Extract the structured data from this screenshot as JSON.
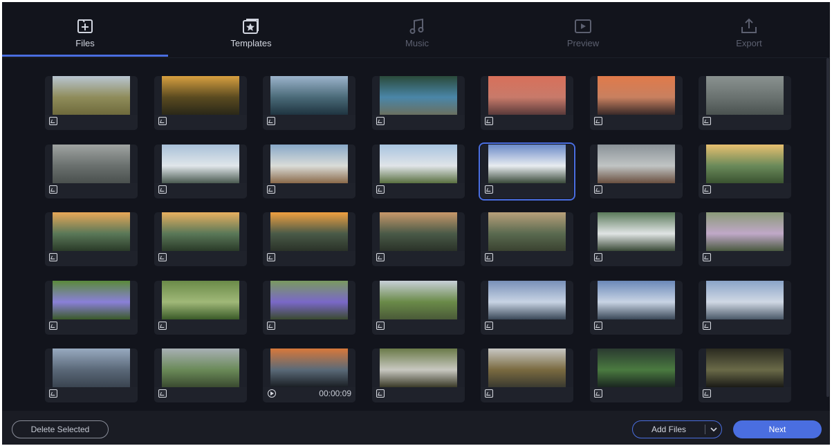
{
  "nav": {
    "tabs": [
      {
        "label": "Files",
        "icon": "add-file-icon",
        "state": "active"
      },
      {
        "label": "Templates",
        "icon": "templates-star-icon",
        "state": "enabled"
      },
      {
        "label": "Music",
        "icon": "music-note-icon",
        "state": "disabled"
      },
      {
        "label": "Preview",
        "icon": "play-preview-icon",
        "state": "disabled"
      },
      {
        "label": "Export",
        "icon": "upload-export-icon",
        "state": "disabled"
      }
    ],
    "accent": "#4a6ee0"
  },
  "grid": {
    "selected_index": 11,
    "items": [
      {
        "type": "image",
        "scene": "field-path",
        "colors": [
          "#b9c6d2",
          "#8f8c5a",
          "#6e6a3c"
        ]
      },
      {
        "type": "image",
        "scene": "sunset-trees",
        "colors": [
          "#d8a040",
          "#5a4a20",
          "#2a2818"
        ]
      },
      {
        "type": "image",
        "scene": "lake-mountains",
        "colors": [
          "#9cb4cc",
          "#4a6a78",
          "#1f3440"
        ]
      },
      {
        "type": "image",
        "scene": "lakeshore-forest",
        "colors": [
          "#2a4a3a",
          "#4a86a8",
          "#6a7060"
        ]
      },
      {
        "type": "image",
        "scene": "pink-sunset-water",
        "colors": [
          "#d8705a",
          "#c87a6a",
          "#5a3a3a"
        ]
      },
      {
        "type": "image",
        "scene": "orange-sunset-shore",
        "colors": [
          "#e07a4a",
          "#c88060",
          "#3a2a28"
        ]
      },
      {
        "type": "image",
        "scene": "sea-waves",
        "colors": [
          "#8a9290",
          "#6a7270",
          "#4a5250"
        ]
      },
      {
        "type": "image",
        "scene": "grey-sea",
        "colors": [
          "#a0a4a2",
          "#6a706e",
          "#4a504e"
        ]
      },
      {
        "type": "image",
        "scene": "clouds-mountains",
        "colors": [
          "#a8c0d8",
          "#e0e6ea",
          "#4a5a50"
        ]
      },
      {
        "type": "image",
        "scene": "big-clouds-valley",
        "colors": [
          "#88a8c8",
          "#dadcd8",
          "#8a6a4a"
        ]
      },
      {
        "type": "image",
        "scene": "snowy-ridge",
        "colors": [
          "#a8c4e0",
          "#e0e4e8",
          "#5a7040"
        ]
      },
      {
        "type": "image",
        "scene": "volcano",
        "colors": [
          "#6a8ac8",
          "#e8ecf0",
          "#3a4a3a"
        ]
      },
      {
        "type": "image",
        "scene": "misty-mountain",
        "colors": [
          "#8a9298",
          "#c0c4c4",
          "#6a5040"
        ]
      },
      {
        "type": "image",
        "scene": "sunset-meadow",
        "colors": [
          "#e8c070",
          "#6a8a5a",
          "#3a5230"
        ]
      },
      {
        "type": "image",
        "scene": "sunset-hills-1",
        "colors": [
          "#e8a858",
          "#5a7858",
          "#2a3a28"
        ]
      },
      {
        "type": "image",
        "scene": "sunset-hills-2",
        "colors": [
          "#e8b060",
          "#5a7858",
          "#2a3a28"
        ]
      },
      {
        "type": "image",
        "scene": "sun-low-hills",
        "colors": [
          "#f0a040",
          "#4a5a48",
          "#2a3228"
        ]
      },
      {
        "type": "image",
        "scene": "dusk-hill",
        "colors": [
          "#c8986a",
          "#4a5a48",
          "#2a3228"
        ]
      },
      {
        "type": "image",
        "scene": "evening-hills",
        "colors": [
          "#b8a07a",
          "#5a6a50",
          "#3a4230"
        ]
      },
      {
        "type": "image",
        "scene": "waterfall",
        "colors": [
          "#5a7a5a",
          "#e0e4e4",
          "#3a4a38"
        ]
      },
      {
        "type": "image",
        "scene": "wildflowers",
        "colors": [
          "#8a9a78",
          "#c0a8c8",
          "#4a5a40"
        ]
      },
      {
        "type": "image",
        "scene": "bluebell-flower",
        "colors": [
          "#5a8a3a",
          "#8a80d8",
          "#3a5a28"
        ]
      },
      {
        "type": "image",
        "scene": "grass-closeup",
        "colors": [
          "#6a8a48",
          "#a0b878",
          "#3a5a28"
        ]
      },
      {
        "type": "image",
        "scene": "iris-flowers",
        "colors": [
          "#7a9a60",
          "#7a68c8",
          "#3a4a30"
        ]
      },
      {
        "type": "image",
        "scene": "green-valley",
        "colors": [
          "#c8d0d8",
          "#6a8a48",
          "#4a5a38"
        ]
      },
      {
        "type": "image",
        "scene": "bay-clouds",
        "colors": [
          "#7890b8",
          "#c8d4e4",
          "#3a4858"
        ]
      },
      {
        "type": "image",
        "scene": "bay-ship",
        "colors": [
          "#6a88b8",
          "#c8d4e4",
          "#3a4858"
        ]
      },
      {
        "type": "image",
        "scene": "bay-volcano",
        "colors": [
          "#8aa4c8",
          "#d0d8e4",
          "#4a5868"
        ]
      },
      {
        "type": "image",
        "scene": "coast-range",
        "colors": [
          "#98aac0",
          "#5a6878",
          "#3a4450"
        ]
      },
      {
        "type": "image",
        "scene": "overcast-meadow",
        "colors": [
          "#a8b0b4",
          "#6a8a58",
          "#3a4a30"
        ]
      },
      {
        "type": "video",
        "scene": "fire-water",
        "duration": "00:00:09",
        "colors": [
          "#d8783a",
          "#5a6a78",
          "#1a1e24"
        ]
      },
      {
        "type": "image",
        "scene": "mossy-cave",
        "colors": [
          "#6a7a48",
          "#c8c8c0",
          "#3a3a28"
        ]
      },
      {
        "type": "image",
        "scene": "valley-road",
        "colors": [
          "#c8c8c4",
          "#7a6a40",
          "#3a3a30"
        ]
      },
      {
        "type": "image",
        "scene": "dark-bush",
        "colors": [
          "#2a3a30",
          "#4a7a40",
          "#1a2620"
        ]
      },
      {
        "type": "image",
        "scene": "night-grass",
        "colors": [
          "#2a2a20",
          "#6a6a48",
          "#1a1a16"
        ]
      }
    ]
  },
  "footer": {
    "delete_label": "Delete Selected",
    "add_files_label": "Add Files",
    "next_label": "Next"
  }
}
